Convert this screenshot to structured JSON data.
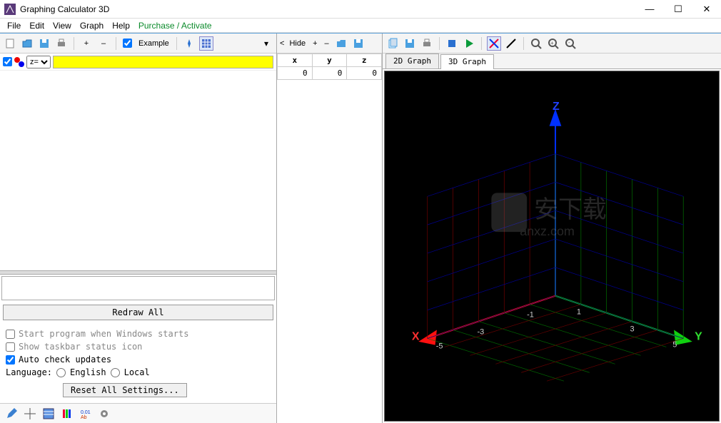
{
  "window": {
    "title": "Graphing Calculator 3D"
  },
  "menu": {
    "file": "File",
    "edit": "Edit",
    "view": "View",
    "graph": "Graph",
    "help": "Help",
    "purchase": "Purchase / Activate"
  },
  "left_toolbar": {
    "example": "Example"
  },
  "equation": {
    "dropdown": "z="
  },
  "redraw": "Redraw All",
  "settings": {
    "startup": "Start program when Windows starts",
    "taskbar": "Show taskbar status icon",
    "updates": "Auto check updates",
    "language_label": "Language:",
    "english": "English",
    "local": "Local",
    "reset": "Reset All Settings..."
  },
  "mid_toolbar": {
    "hide": "Hide",
    "plus": "+",
    "minus": "–"
  },
  "table": {
    "headers": [
      "x",
      "y",
      "z"
    ],
    "row": [
      "0",
      "0",
      "0"
    ]
  },
  "tabs": {
    "g2d": "2D Graph",
    "g3d": "3D Graph"
  },
  "axes": {
    "x": "X",
    "y": "Y",
    "z": "Z",
    "ticks_neg": "-5",
    "ticks_n3": "-3",
    "ticks_n1": "-1",
    "ticks_p1": "1",
    "ticks_p3": "3",
    "ticks_p5": "5"
  },
  "watermark": "anxz.com",
  "chart_data": {
    "type": "3d-axes",
    "title": "",
    "x_range": [
      -5,
      5
    ],
    "y_range": [
      -5,
      5
    ],
    "z_range": [
      -5,
      5
    ],
    "x_color": "#ff0000",
    "y_color": "#00ff00",
    "z_color": "#0000ff",
    "grid": true,
    "series": []
  }
}
